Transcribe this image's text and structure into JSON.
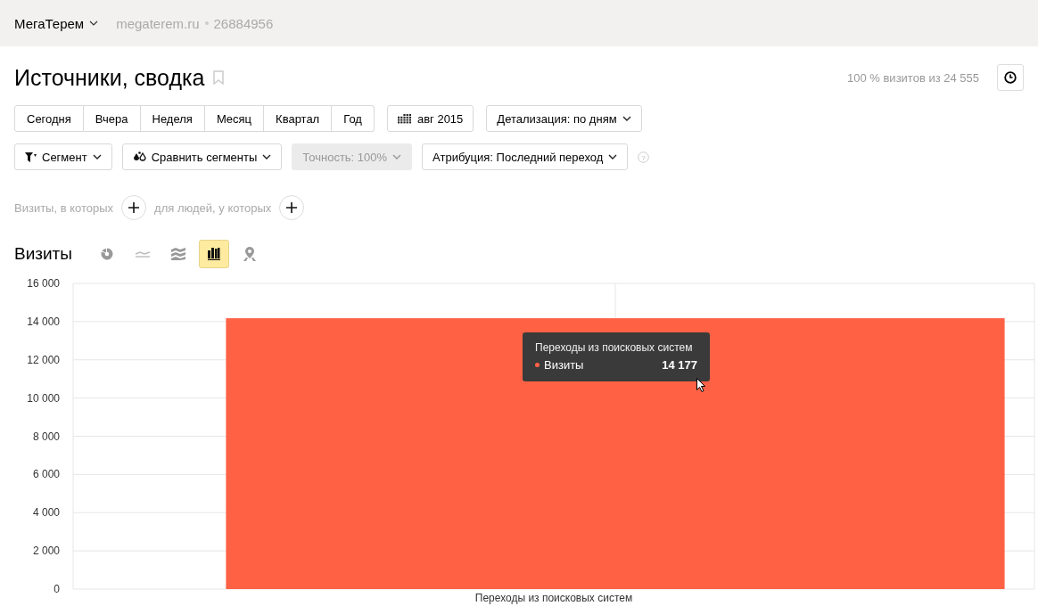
{
  "header": {
    "account": "МегаТерем",
    "site": "megaterem.ru",
    "counter_id": "26884956"
  },
  "page": {
    "title": "Источники, сводка",
    "sample_info": "100 % визитов из 24 555"
  },
  "periods": [
    {
      "label": "Сегодня",
      "selected": false
    },
    {
      "label": "Вчера",
      "selected": false
    },
    {
      "label": "Неделя",
      "selected": false
    },
    {
      "label": "Месяц",
      "selected": false
    },
    {
      "label": "Квартал",
      "selected": false
    },
    {
      "label": "Год",
      "selected": false
    }
  ],
  "date_button": "авг 2015",
  "detail_dropdown": "Детализация: по дням",
  "filters": [
    {
      "label": "Сегмент",
      "kind": "segment",
      "disabled": false
    },
    {
      "label": "Сравнить сегменты",
      "kind": "compare",
      "disabled": false
    },
    {
      "label": "Точность: 100%",
      "kind": "plain",
      "disabled": true
    },
    {
      "label": "Атрибуция: Последний переход",
      "kind": "plain",
      "disabled": false
    }
  ],
  "help_mark": "?",
  "conditions": [
    "Визиты, в которых",
    "для людей, у которых"
  ],
  "chart_section": {
    "title": "Визиты",
    "chart_types": [
      {
        "kind": "pie",
        "selected": false
      },
      {
        "kind": "line",
        "selected": false
      },
      {
        "kind": "area",
        "selected": false
      },
      {
        "kind": "bar",
        "selected": true
      },
      {
        "kind": "map",
        "selected": false
      }
    ]
  },
  "chart_data": {
    "type": "bar",
    "categories": [
      "Переходы из поисковых систем"
    ],
    "series": [
      {
        "name": "Визиты",
        "color": "#ff6145",
        "values": [
          14177
        ]
      }
    ],
    "ylim": [
      0,
      16000
    ],
    "grid": true,
    "yticks": [
      {
        "value": 0,
        "label": "0"
      },
      {
        "value": 2000,
        "label": "2 000"
      },
      {
        "value": 4000,
        "label": "4 000"
      },
      {
        "value": 6000,
        "label": "6 000"
      },
      {
        "value": 8000,
        "label": "8 000"
      },
      {
        "value": 10000,
        "label": "10 000"
      },
      {
        "value": 12000,
        "label": "12 000"
      },
      {
        "value": 14000,
        "label": "14 000"
      },
      {
        "value": 16000,
        "label": "16 000"
      }
    ]
  },
  "tooltip": {
    "title": "Переходы из поисковых систем",
    "value": "14 177"
  }
}
